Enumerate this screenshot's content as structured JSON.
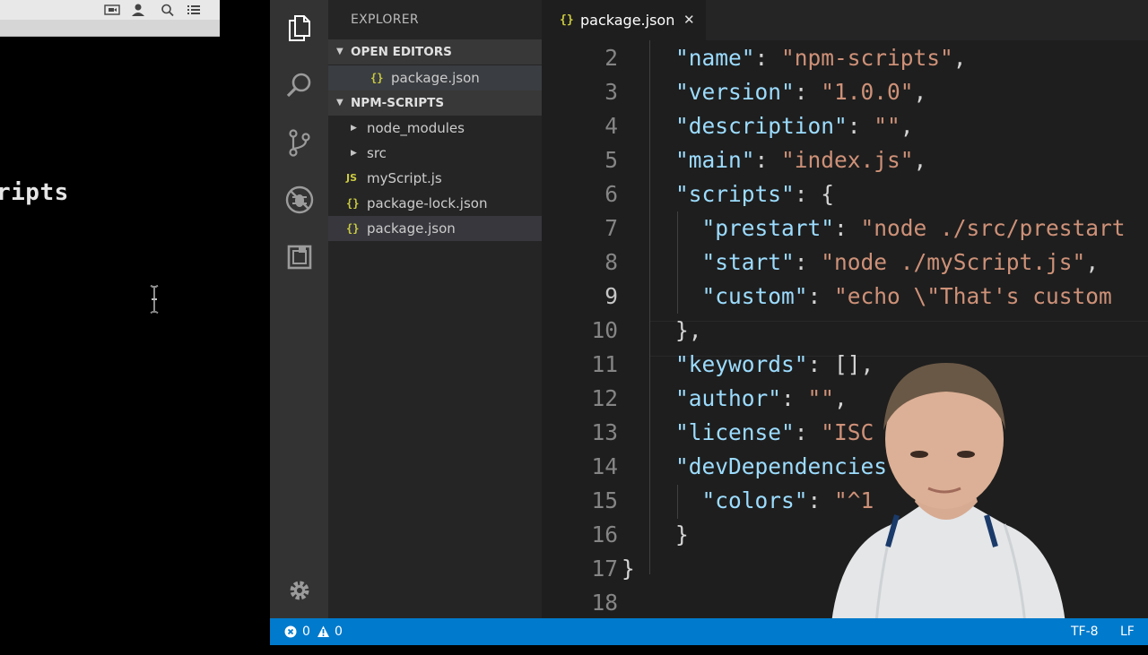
{
  "terminal": {
    "visible_text": "ripts",
    "toolbar_icons": [
      "screen-record-icon",
      "user-icon",
      "search-icon",
      "list-icon"
    ]
  },
  "activity_bar": {
    "icons": [
      "files-icon",
      "search-icon",
      "source-control-icon",
      "debug-icon",
      "extensions-icon",
      "gear-icon"
    ]
  },
  "sidebar": {
    "title": "EXPLORER",
    "open_editors": {
      "label": "OPEN EDITORS",
      "items": [
        {
          "name": "package.json",
          "icon": "{}"
        }
      ]
    },
    "project": {
      "label": "NPM-SCRIPTS",
      "items": [
        {
          "name": "node_modules",
          "type": "folder"
        },
        {
          "name": "src",
          "type": "folder"
        },
        {
          "name": "myScript.js",
          "type": "js",
          "icon": "JS"
        },
        {
          "name": "package-lock.json",
          "type": "json",
          "icon": "{}"
        },
        {
          "name": "package.json",
          "type": "json",
          "icon": "{}",
          "selected": true
        }
      ]
    }
  },
  "editor": {
    "tab": {
      "icon": "{}",
      "label": "package.json",
      "close": "✕"
    },
    "current_line": 9,
    "lines": [
      {
        "n": "2",
        "tokens": [
          {
            "t": "k",
            "v": "\"name\""
          },
          {
            "t": "p",
            "v": ": "
          },
          {
            "t": "s",
            "v": "\"npm-scripts\""
          },
          {
            "t": "p",
            "v": ","
          }
        ]
      },
      {
        "n": "3",
        "tokens": [
          {
            "t": "k",
            "v": "\"version\""
          },
          {
            "t": "p",
            "v": ": "
          },
          {
            "t": "s",
            "v": "\"1.0.0\""
          },
          {
            "t": "p",
            "v": ","
          }
        ]
      },
      {
        "n": "4",
        "tokens": [
          {
            "t": "k",
            "v": "\"description\""
          },
          {
            "t": "p",
            "v": ": "
          },
          {
            "t": "s",
            "v": "\"\""
          },
          {
            "t": "p",
            "v": ","
          }
        ]
      },
      {
        "n": "5",
        "tokens": [
          {
            "t": "k",
            "v": "\"main\""
          },
          {
            "t": "p",
            "v": ": "
          },
          {
            "t": "s",
            "v": "\"index.js\""
          },
          {
            "t": "p",
            "v": ","
          }
        ]
      },
      {
        "n": "6",
        "tokens": [
          {
            "t": "k",
            "v": "\"scripts\""
          },
          {
            "t": "p",
            "v": ": {"
          }
        ]
      },
      {
        "n": "7",
        "tokens": [
          {
            "t": "p",
            "v": "  "
          },
          {
            "t": "k",
            "v": "\"prestart\""
          },
          {
            "t": "p",
            "v": ": "
          },
          {
            "t": "s",
            "v": "\"node ./src/prestart"
          }
        ]
      },
      {
        "n": "8",
        "tokens": [
          {
            "t": "p",
            "v": "  "
          },
          {
            "t": "k",
            "v": "\"start\""
          },
          {
            "t": "p",
            "v": ": "
          },
          {
            "t": "s",
            "v": "\"node ./myScript.js\""
          },
          {
            "t": "p",
            "v": ","
          }
        ]
      },
      {
        "n": "9",
        "tokens": [
          {
            "t": "p",
            "v": "  "
          },
          {
            "t": "k",
            "v": "\"custom\""
          },
          {
            "t": "p",
            "v": ": "
          },
          {
            "t": "s",
            "v": "\"echo \\\"That's custom "
          }
        ]
      },
      {
        "n": "10",
        "tokens": [
          {
            "t": "p",
            "v": "},"
          }
        ]
      },
      {
        "n": "11",
        "tokens": [
          {
            "t": "k",
            "v": "\"keywords\""
          },
          {
            "t": "p",
            "v": ": [],"
          }
        ]
      },
      {
        "n": "12",
        "tokens": [
          {
            "t": "k",
            "v": "\"author\""
          },
          {
            "t": "p",
            "v": ": "
          },
          {
            "t": "s",
            "v": "\"\""
          },
          {
            "t": "p",
            "v": ","
          }
        ]
      },
      {
        "n": "13",
        "tokens": [
          {
            "t": "k",
            "v": "\"license\""
          },
          {
            "t": "p",
            "v": ": "
          },
          {
            "t": "s",
            "v": "\"ISC"
          }
        ]
      },
      {
        "n": "14",
        "tokens": [
          {
            "t": "k",
            "v": "\"devDependencies"
          }
        ]
      },
      {
        "n": "15",
        "tokens": [
          {
            "t": "p",
            "v": "  "
          },
          {
            "t": "k",
            "v": "\"colors\""
          },
          {
            "t": "p",
            "v": ": "
          },
          {
            "t": "s",
            "v": "\"^1"
          }
        ]
      },
      {
        "n": "16",
        "tokens": [
          {
            "t": "p",
            "v": "}"
          }
        ]
      },
      {
        "n": "17",
        "tokens": [
          {
            "t": "p",
            "v": "}"
          }
        ]
      },
      {
        "n": "18",
        "tokens": []
      }
    ]
  },
  "status_bar": {
    "errors": "0",
    "warnings": "0",
    "encoding": "TF-8",
    "eol": "LF"
  },
  "colors": {
    "status_bar": "#007acc",
    "activity_bar": "#333333",
    "sidebar": "#252526",
    "editor": "#1e1e1e",
    "json_key": "#9cdcfe",
    "json_string": "#ce9178"
  }
}
